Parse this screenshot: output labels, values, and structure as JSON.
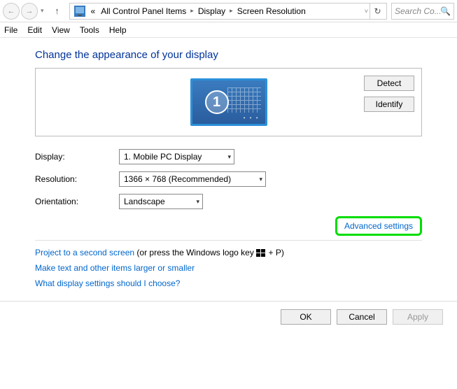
{
  "nav": {
    "breadcrumb_prefix": "«",
    "crumbs": [
      "All Control Panel Items",
      "Display",
      "Screen Resolution"
    ],
    "search_placeholder": "Search Co..."
  },
  "menubar": [
    "File",
    "Edit",
    "View",
    "Tools",
    "Help"
  ],
  "page": {
    "title": "Change the appearance of your display",
    "monitor_number": "1",
    "detect": "Detect",
    "identify": "Identify"
  },
  "form": {
    "display_label": "Display:",
    "display_value": "1. Mobile PC Display",
    "resolution_label": "Resolution:",
    "resolution_value": "1366 × 768 (Recommended)",
    "orientation_label": "Orientation:",
    "orientation_value": "Landscape"
  },
  "links": {
    "advanced": "Advanced settings",
    "project_a": "Project to a second screen",
    "project_b": " (or press the Windows logo key ",
    "project_c": " + P)",
    "text_size": "Make text and other items larger or smaller",
    "which": "What display settings should I choose?"
  },
  "footer": {
    "ok": "OK",
    "cancel": "Cancel",
    "apply": "Apply"
  }
}
